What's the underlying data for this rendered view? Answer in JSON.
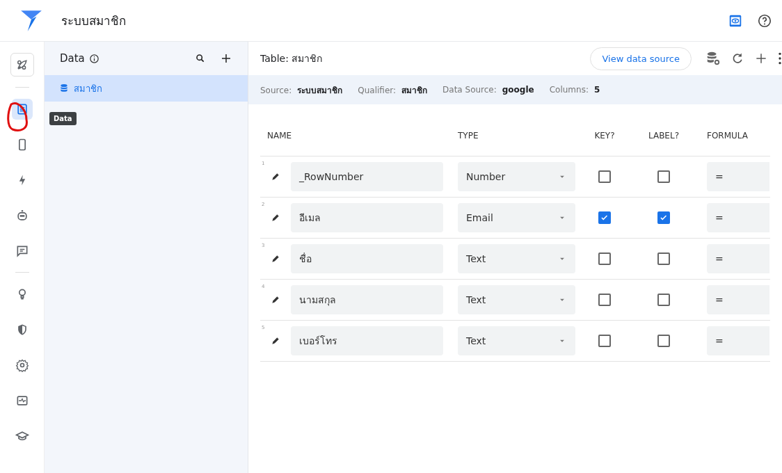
{
  "app": {
    "title": "ระบบสมาชิก"
  },
  "rail": {
    "items": [
      {
        "kind": "rocket",
        "selected": false
      },
      {
        "kind": "divider"
      },
      {
        "kind": "data",
        "selected": true
      },
      {
        "kind": "phone",
        "selected": false
      },
      {
        "kind": "bolt",
        "selected": false
      },
      {
        "kind": "bot",
        "selected": false
      },
      {
        "kind": "chat",
        "selected": false
      },
      {
        "kind": "divider"
      },
      {
        "kind": "bulb",
        "selected": false
      },
      {
        "kind": "shield",
        "selected": false
      },
      {
        "kind": "gear",
        "selected": false
      },
      {
        "kind": "monitor",
        "selected": false
      },
      {
        "kind": "school",
        "selected": false
      }
    ],
    "tooltip": "Data"
  },
  "data_panel": {
    "title": "Data",
    "tables": [
      {
        "name": "สมาชิก",
        "selected": true
      }
    ]
  },
  "table": {
    "title": "Table: สมาชิก",
    "view_button": "View data source",
    "meta": [
      {
        "label": "Source:",
        "value": "ระบบสมาชิก"
      },
      {
        "label": "Qualifier:",
        "value": "สมาชิก"
      },
      {
        "label": "Data Source:",
        "value": "google"
      },
      {
        "label": "Columns:",
        "value": "5"
      }
    ],
    "columns": [
      "NAME",
      "TYPE",
      "KEY?",
      "LABEL?",
      "FORMULA"
    ],
    "rows": [
      {
        "index": "1",
        "name": "_RowNumber",
        "type": "Number",
        "key": false,
        "label": false,
        "formula": "="
      },
      {
        "index": "2",
        "name": "อีเมล",
        "type": "Email",
        "key": true,
        "label": true,
        "formula": "="
      },
      {
        "index": "3",
        "name": "ชื่อ",
        "type": "Text",
        "key": false,
        "label": false,
        "formula": "="
      },
      {
        "index": "4",
        "name": "นามสกุล",
        "type": "Text",
        "key": false,
        "label": false,
        "formula": "="
      },
      {
        "index": "5",
        "name": "เบอร์โทร",
        "type": "Text",
        "key": false,
        "label": false,
        "formula": "="
      }
    ]
  }
}
